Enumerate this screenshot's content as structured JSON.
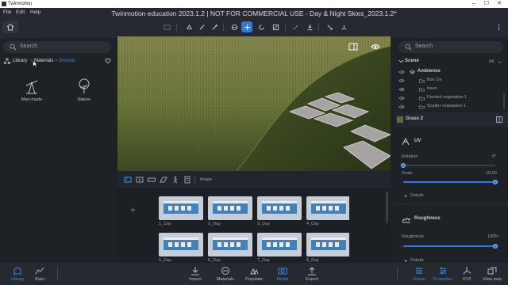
{
  "titlebar": {
    "title": "Twinmotion",
    "controls": [
      "–",
      "☐",
      "✕"
    ]
  },
  "menu": [
    "File",
    "Edit",
    "Help"
  ],
  "app_title": "Twinmotion education 2023.1.2 | NOT FOR COMMERCIAL USE - Day & Night Skies_2023.1.2*",
  "left_panel": {
    "search_placeholder": "Search",
    "breadcrumb": {
      "root": "Library",
      "sep1": ">",
      "level1": "Materials",
      "sep2": ">",
      "current": "Ground"
    },
    "items": [
      {
        "label": "Man-made",
        "icon": "crane-icon"
      },
      {
        "label": "Nature",
        "icon": "tree-icon"
      }
    ]
  },
  "media": {
    "section_label": "Image",
    "thumbnails": [
      {
        "label": "1_Day"
      },
      {
        "label": "2_Day"
      },
      {
        "label": "3_Day"
      },
      {
        "label": "4_Day"
      },
      {
        "label": "5_Day"
      },
      {
        "label": "6_Day"
      },
      {
        "label": "7_Day"
      },
      {
        "label": "8_Day"
      }
    ]
  },
  "right_panel": {
    "search_placeholder": "Search",
    "scene": {
      "title": "Scene",
      "filter": "All"
    },
    "tree": [
      {
        "label": "Ambience",
        "level": 0,
        "bold": true
      },
      {
        "label": "Box 1m",
        "level": 1
      },
      {
        "label": "trees",
        "level": 1
      },
      {
        "label": "Painted vegetation 1",
        "level": 1
      },
      {
        "label": "Scatter vegetation 1",
        "level": 1
      }
    ],
    "material": {
      "name": "Grass 2"
    },
    "uv": {
      "title": "UV",
      "rotation_label": "Rotation",
      "rotation_value": "0°",
      "rotation_level": 0.0,
      "scale_label": "Scale",
      "scale_value": "10.00",
      "scale_level": 1.0,
      "details": "Details"
    },
    "roughness": {
      "title": "Roughness",
      "label": "Roughness",
      "value": "100%",
      "level": 1.0,
      "details": "Details"
    }
  },
  "footer": {
    "left": [
      {
        "label": "Library",
        "active": true
      },
      {
        "label": "Stats",
        "active": false
      }
    ],
    "center": [
      {
        "label": "Import",
        "active": false
      },
      {
        "label": "Materials",
        "active": false
      },
      {
        "label": "Populate",
        "active": false
      },
      {
        "label": "Media",
        "active": true
      },
      {
        "label": "Export",
        "active": false
      }
    ],
    "right": [
      {
        "label": "Scene",
        "active": true
      },
      {
        "label": "Properties",
        "active": true
      },
      {
        "label": "XYZ",
        "active": false
      },
      {
        "label": "View sets",
        "active": false
      }
    ]
  },
  "colors": {
    "accent": "#2d7be0",
    "panel": "#1e2126",
    "header": "#262a30"
  }
}
